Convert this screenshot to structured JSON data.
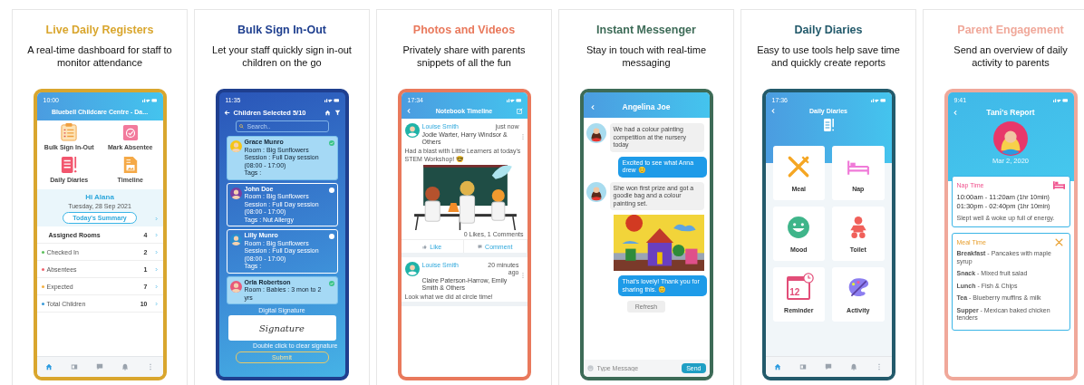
{
  "cards": [
    {
      "kind": "dashboard",
      "title": "Live Daily Registers",
      "color": "#d9a62e",
      "subtitle": "A real-time dashboard for staff to monitor attendance",
      "screen": {
        "time": "10:00",
        "header": "Bluebell Childcare Centre - Da...",
        "tiles": [
          "Bulk Sign In-Out",
          "Mark Absentee",
          "Daily Diaries",
          "Timeline"
        ],
        "greeting": "Hi Alana",
        "date": "Tuesday, 28 Sep 2021",
        "summary_button": "Today's Summary",
        "rows": [
          {
            "kind": "total",
            "label": "Assigned Rooms",
            "value": "4"
          },
          {
            "kind": "stat",
            "label": "Checked In",
            "value": "2",
            "color": "#5cc05c"
          },
          {
            "kind": "stat",
            "label": "Absentees",
            "value": "1",
            "color": "#f0646e"
          },
          {
            "kind": "stat",
            "label": "Expected",
            "value": "7",
            "color": "#f5b142"
          },
          {
            "kind": "stat",
            "label": "Total Children",
            "value": "10",
            "color": "#3a9ad9"
          }
        ],
        "tab_bar": [
          {
            "selected": true
          },
          {
            "selected": false
          },
          {
            "selected": false
          },
          {
            "selected": false
          },
          {
            "selected": false
          }
        ]
      }
    },
    {
      "kind": "sign",
      "title": "Bulk Sign In-Out",
      "color": "#1f3f8f",
      "subtitle": "Let your staff quickly sign in-out children on the go",
      "screen": {
        "time": "11:35",
        "header": "Children Selected 5/10",
        "search_placeholder": "Search..",
        "children": [
          {
            "name": "Grace Munro",
            "details": [
              "Room : Big Sunflowers",
              "Session : Full Day session (08:00 - 17:00)",
              "Tags :"
            ],
            "selected": true
          },
          {
            "name": "John Doe",
            "details": [
              "Room : Big Sunflowers",
              "Session : Full Day session (08:00 - 17:00)",
              "Tags : Nut Allergy"
            ],
            "selected": false
          },
          {
            "name": "Lilly Munro",
            "details": [
              "Room : Big Sunflowers",
              "Session : Full Day session (08:00 - 17:00)",
              "Tags :"
            ],
            "selected": false
          },
          {
            "name": "Orla Robertson",
            "details": [
              "Room : Babies : 3 mon to 2 yrs"
            ],
            "selected": true
          }
        ],
        "signature_label": "Digital Signature",
        "signature": "Signature",
        "signature_hint": "Double click to clear signature",
        "submit": "Submit"
      }
    },
    {
      "kind": "timeline",
      "title": "Photos and Videos",
      "color": "#e9795c",
      "subtitle": "Privately share with parents snippets of all the fun",
      "screen": {
        "time": "17:34",
        "header": "Notebook Timeline",
        "posts": [
          {
            "author": "Louise Smith",
            "time": "just now",
            "tagged": "Jodie Warter, Harry Windsor & Others",
            "text": "Had a blast with Little Learners at today's STEM Workshop! 🤓",
            "media": {
              "kind": "picture"
            },
            "stats": "0 Likes, 1 Comments",
            "actions": [
              "Like",
              "Comment"
            ]
          },
          {
            "author": "Louise Smith",
            "time": "20 minutes ago",
            "tagged": "Claire Paterson-Harrow, Emily Smith & Others",
            "text": "Look what we did at circle time!"
          }
        ]
      }
    },
    {
      "kind": "chat",
      "title": "Instant Messenger",
      "color": "#3d6b57",
      "subtitle": "Stay in touch with real-time messaging",
      "screen": {
        "header": "Angelina Joe",
        "messages": [
          {
            "kind": "in",
            "text": "We had a colour painting competition at the nursery today"
          },
          {
            "kind": "out",
            "text": "Excited to see what Anna drew 😊"
          },
          {
            "kind": "in",
            "text": "She won first prize and got a goodie bag and a colour painting set."
          },
          {
            "kind": "picture"
          },
          {
            "kind": "out",
            "text": "That's lovely! Thank you for sharing this. 😊"
          }
        ],
        "refresh": "Refresh",
        "input_placeholder": "Type Message",
        "send": "Send"
      }
    },
    {
      "kind": "diaries",
      "title": "Daily Diaries",
      "color": "#235a6b",
      "subtitle": "Easy to use tools help save time and quickly create reports",
      "screen": {
        "time": "17:36",
        "header": "Daily Diaries",
        "tiles": [
          {
            "kind": "meal",
            "label": "Meal"
          },
          {
            "kind": "nap",
            "label": "Nap"
          },
          {
            "kind": "mood",
            "label": "Mood"
          },
          {
            "kind": "toilet",
            "label": "Toilet"
          },
          {
            "kind": "reminder",
            "label": "Reminder",
            "icon_text": "12"
          },
          {
            "kind": "activity",
            "label": "Activity"
          }
        ],
        "tab_bar": [
          {
            "selected": true
          },
          {
            "selected": false
          },
          {
            "selected": false
          },
          {
            "selected": false
          },
          {
            "selected": false
          }
        ]
      }
    },
    {
      "kind": "report",
      "title": "Parent Engagement",
      "color": "#f0a89a",
      "subtitle": "Send an overview of daily activity to parents",
      "screen": {
        "time": "9:41",
        "header": "Tani's Report",
        "date": "Mar 2, 2020",
        "sections": [
          {
            "kind": "nap",
            "title": "Nap Time",
            "color": "#f0508c",
            "times": [
              {
                "range": "10:00am - 11:20am",
                "duration": "(1hr 10min)"
              },
              {
                "range": "01:30pm - 02:40pm",
                "duration": "(1hr 10min)"
              }
            ],
            "note": "Slept well & woke up full of energy."
          },
          {
            "kind": "meal",
            "title": "Meal Time",
            "color": "#e8a030",
            "items": [
              "**Breakfast** - Pancakes with maple syrup",
              "**Snack** - Mixed fruit salad",
              "**Lunch** - Fish & Chips",
              "**Tea** - Blueberry muffins & milk",
              "**Supper** -  Mexican baked chicken tenders"
            ]
          }
        ]
      }
    }
  ]
}
